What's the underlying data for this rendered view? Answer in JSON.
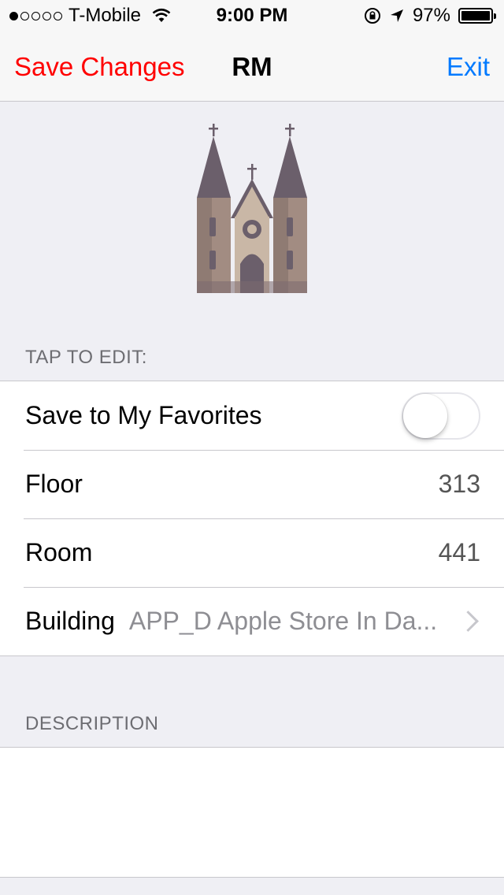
{
  "status_bar": {
    "carrier": "T-Mobile",
    "time": "9:00 PM",
    "battery": "97%",
    "signal_bars_filled": 1,
    "signal_bars_total": 5
  },
  "nav": {
    "left_button": "Save Changes",
    "title": "RM",
    "right_button": "Exit",
    "left_color": "#ff0000",
    "right_color": "#007aff"
  },
  "hero": {
    "icon": "cathedral-icon"
  },
  "edit_section": {
    "header": "TAP TO EDIT:",
    "rows": [
      {
        "label": "Save to My Favorites",
        "type": "toggle",
        "on": false
      },
      {
        "label": "Floor",
        "value": "313"
      },
      {
        "label": "Room",
        "value": "441"
      },
      {
        "label": "Building",
        "value": "APP_D Apple Store In Da..."
      }
    ]
  },
  "description_section": {
    "header": "DESCRIPTION",
    "text": ""
  }
}
